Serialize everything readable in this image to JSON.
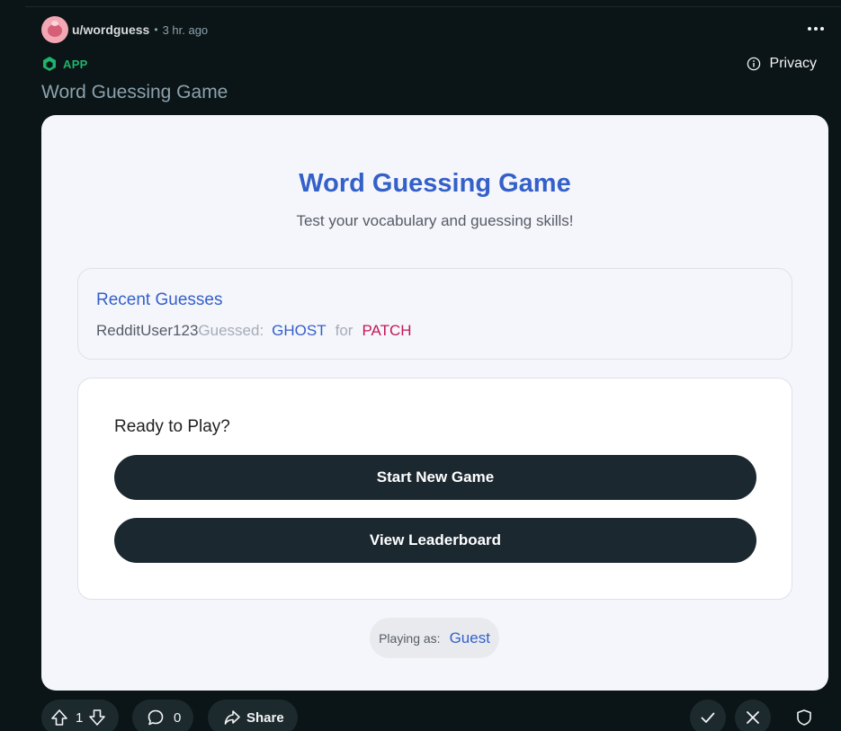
{
  "post": {
    "username": "u/wordguess",
    "separator": "•",
    "time_ago": "3 hr. ago",
    "app_label": "APP",
    "privacy_label": "Privacy",
    "title": "Word Guessing Game"
  },
  "game": {
    "title": "Word Guessing Game",
    "subtitle": "Test your vocabulary and guessing skills!",
    "recent": {
      "heading": "Recent Guesses",
      "guesses": [
        {
          "user": "RedditUser123",
          "verb": "Guessed:",
          "word": "GHOST",
          "connector": "for",
          "answer": "PATCH"
        }
      ]
    },
    "play": {
      "heading": "Ready to Play?",
      "start_label": "Start New Game",
      "leaderboard_label": "View Leaderboard"
    },
    "playing_as": {
      "label": "Playing as:",
      "value": "Guest"
    }
  },
  "actions": {
    "vote_count": "1",
    "comment_count": "0",
    "share_label": "Share"
  },
  "icons": {
    "more": "more-horizontal-icon",
    "app": "app-cube-icon",
    "info": "info-icon",
    "upvote": "upvote-icon",
    "downvote": "downvote-icon",
    "comment": "comment-icon",
    "share": "share-icon",
    "approve": "check-icon",
    "remove": "close-icon",
    "shield": "shield-icon"
  },
  "colors": {
    "page_bg": "#0b1416",
    "card_bg": "#f5f6fb",
    "accent_blue": "#3460c9",
    "answer_pink": "#c2185b",
    "app_green": "#1fb36b",
    "button_dark": "#1c2830"
  }
}
